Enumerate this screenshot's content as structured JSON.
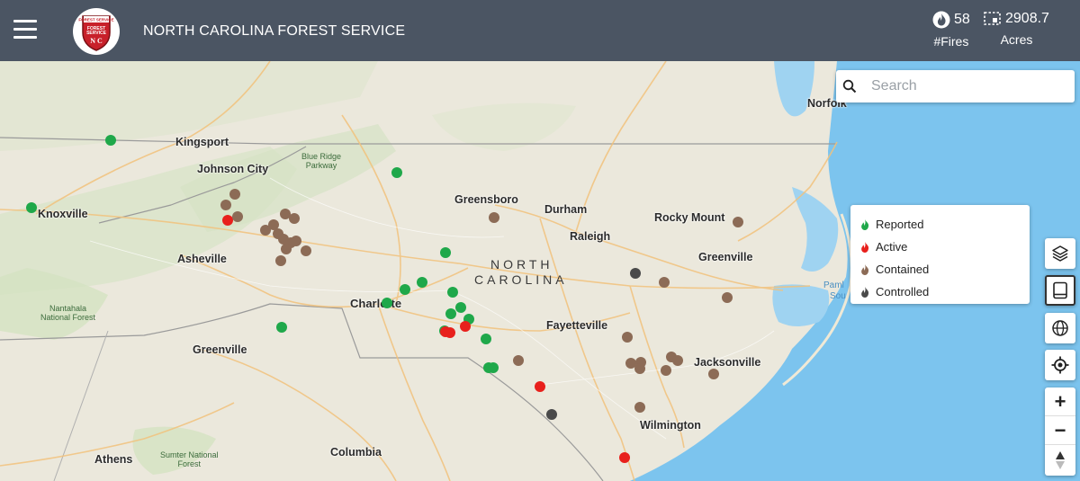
{
  "header": {
    "title": "NORTH CAROLINA FOREST SERVICE",
    "logo_text_top": "FOREST SERVICE",
    "logo_text_bottom": "N C",
    "fires_value": "58",
    "fires_label": "#Fires",
    "acres_value": "2908.7",
    "acres_label": "Acres"
  },
  "search": {
    "placeholder": "Search"
  },
  "legend": {
    "items": [
      {
        "label": "Reported",
        "color": "#1fa84a"
      },
      {
        "label": "Active",
        "color": "#e8201c"
      },
      {
        "label": "Contained",
        "color": "#8c6b56"
      },
      {
        "label": "Controlled",
        "color": "#4a4a4a"
      }
    ]
  },
  "map_labels": {
    "kingsport": "Kingsport",
    "johnson_city": "Johnson City",
    "knoxville": "Knoxville",
    "asheville": "Asheville",
    "blue_ridge": "Blue Ridge\nParkway",
    "greensboro": "Greensboro",
    "durham": "Durham",
    "raleigh": "Raleigh",
    "rocky_mount": "Rocky Mount",
    "greenville_nc": "Greenville",
    "norfolk": "Norfolk",
    "north": "NORTH",
    "carolina": "CAROLINA",
    "charlotte": "Charlotte",
    "fayetteville": "Fayetteville",
    "nantahala": "Nantahala\nNational Forest",
    "greenville_sc": "Greenville",
    "jacksonville": "Jacksonville",
    "wilmington": "Wilmington",
    "athens": "Athens",
    "sumter": "Sumter National\nForest",
    "columbia": "Columbia",
    "pamlico": "Paml",
    "sound": "Sou"
  },
  "colors": {
    "reported": "#1fa84a",
    "active": "#e8201c",
    "contained": "#8c6b56",
    "controlled": "#4a4a4a",
    "header": "#4b5563",
    "water": "#7cc4ee"
  },
  "fires": [
    {
      "status": "reported"
    },
    {
      "status": "reported"
    },
    {
      "status": "reported"
    },
    {
      "status": "reported"
    },
    {
      "status": "reported"
    },
    {
      "status": "reported"
    },
    {
      "status": "reported"
    },
    {
      "status": "reported"
    },
    {
      "status": "reported"
    },
    {
      "status": "reported"
    },
    {
      "status": "reported"
    },
    {
      "status": "reported"
    },
    {
      "status": "reported"
    },
    {
      "status": "reported"
    },
    {
      "status": "reported"
    },
    {
      "status": "reported"
    },
    {
      "status": "active"
    },
    {
      "status": "active"
    },
    {
      "status": "active"
    },
    {
      "status": "active"
    },
    {
      "status": "active"
    },
    {
      "status": "active"
    },
    {
      "status": "contained"
    },
    {
      "status": "contained"
    },
    {
      "status": "contained"
    },
    {
      "status": "contained"
    },
    {
      "status": "contained"
    },
    {
      "status": "contained"
    },
    {
      "status": "contained"
    },
    {
      "status": "contained"
    },
    {
      "status": "contained"
    },
    {
      "status": "contained"
    },
    {
      "status": "contained"
    },
    {
      "status": "contained"
    },
    {
      "status": "contained"
    },
    {
      "status": "contained"
    },
    {
      "status": "contained"
    },
    {
      "status": "contained"
    },
    {
      "status": "contained"
    },
    {
      "status": "contained"
    },
    {
      "status": "contained"
    },
    {
      "status": "contained"
    },
    {
      "status": "contained"
    },
    {
      "status": "contained"
    },
    {
      "status": "contained"
    },
    {
      "status": "contained"
    },
    {
      "status": "contained"
    },
    {
      "status": "contained"
    },
    {
      "status": "contained"
    },
    {
      "status": "contained"
    },
    {
      "status": "controlled"
    },
    {
      "status": "controlled"
    }
  ]
}
